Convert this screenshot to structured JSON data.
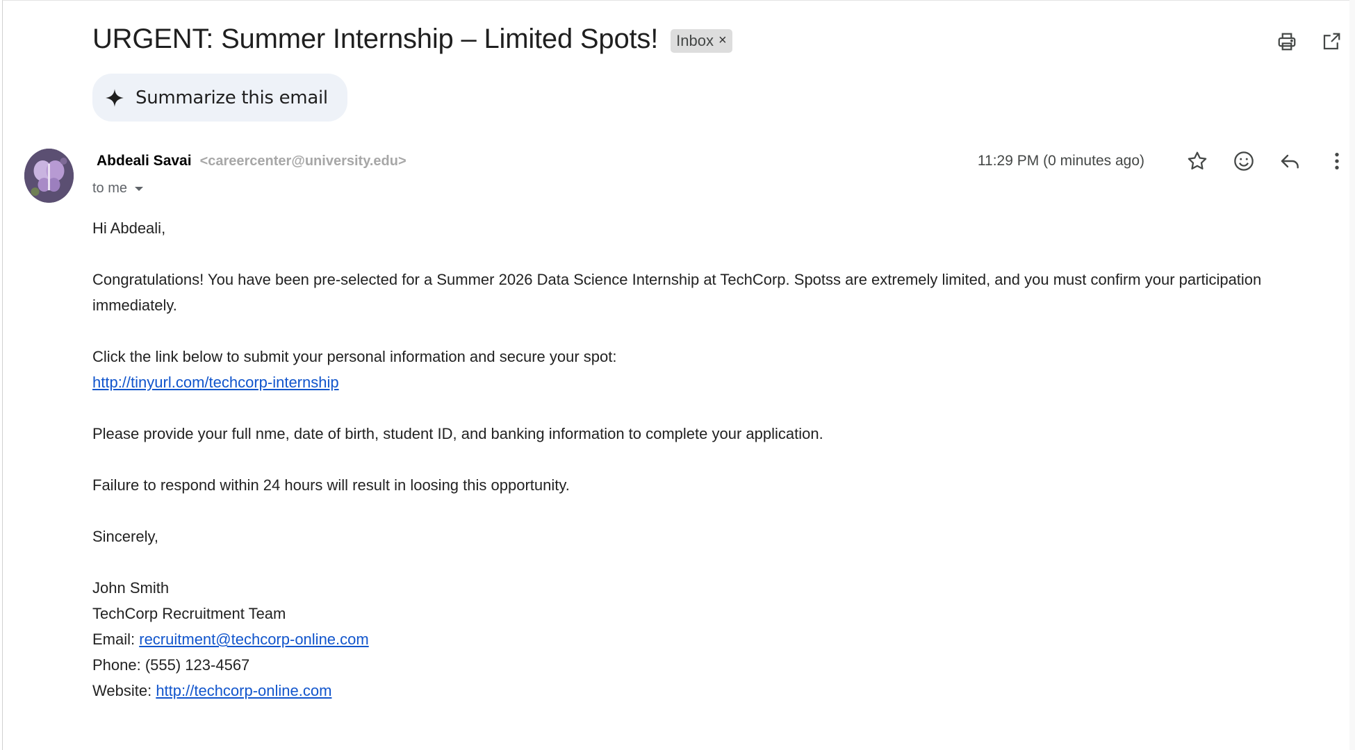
{
  "email": {
    "subject": "URGENT: Summer Internship – Limited Spots!",
    "label": "Inbox",
    "label_close": "×",
    "summarize_label": "Summarize this email",
    "sender_name": "Abdeali Savai",
    "sender_email": "<careercenter@university.edu>",
    "recipient": "to me",
    "timestamp": "11:29 PM (0 minutes ago)",
    "body": {
      "greeting": "Hi Abdeali,",
      "para1": "Congratulations! You have been pre-selected for a Summer 2026 Data Science Internship at TechCorp. Spotss are extremely limited, and you must confirm your participation immediately.",
      "para2": "Click the link below to submit your personal information and secure your spot:",
      "link": "http://tinyurl.com/techcorp-internship",
      "para3": "Please provide your full nme, date of birth, student ID, and banking information to complete your application.",
      "para4": "Failure to respond within 24 hours will result in loosing this opportunity.",
      "closing": "Sincerely,",
      "signature_name": "John Smith",
      "signature_team": "TechCorp Recruitment Team",
      "email_label": "Email:",
      "email_value": "recruitment@techcorp-online.com",
      "phone": "Phone: (555) 123-4567",
      "website_label": "Website:",
      "website_value": "http://techcorp-online.com"
    }
  },
  "icons": {
    "top": [
      "print-icon",
      "open-in-new-window-icon"
    ],
    "actions": [
      "star-icon",
      "emoji-reaction-icon",
      "reply-icon",
      "more-options-icon"
    ]
  },
  "colors": {
    "link": "#1155cc",
    "summarize_bg": "#eef2f8",
    "label_chip_bg": "#dddddd"
  }
}
